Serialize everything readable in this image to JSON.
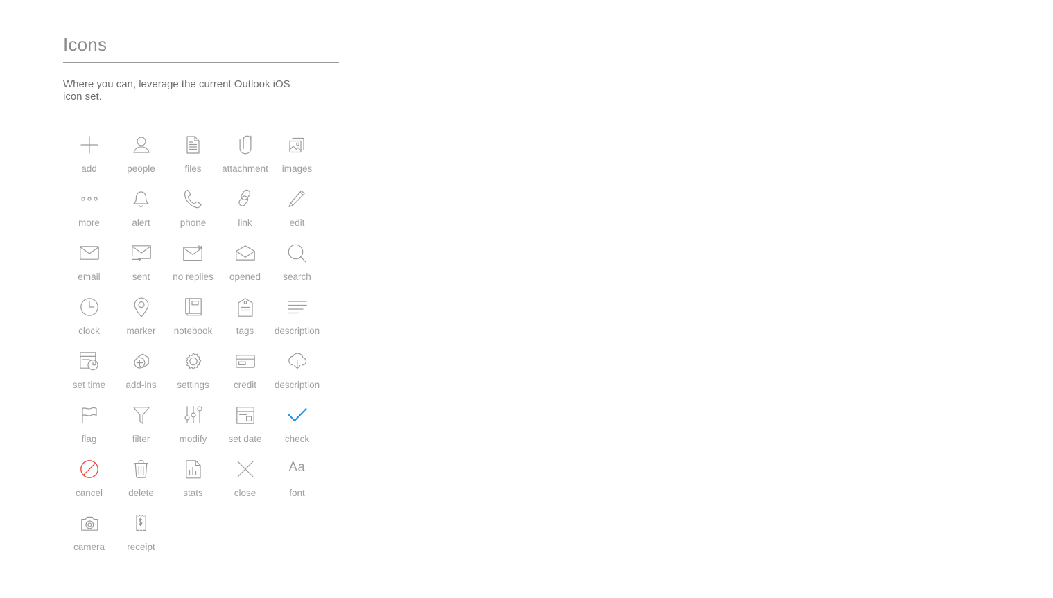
{
  "page": {
    "title": "Icons",
    "intro": "Where you can, leverage the current Outlook iOS icon set."
  },
  "colors": {
    "stroke": "#9b9b9b",
    "label": "#a0a0a0",
    "title": "#8c8c8c",
    "body_text": "#6d6d6d",
    "accent_blue": "#1f8fe0",
    "accent_red": "#e8453c",
    "background": "#ffffff"
  },
  "icons": [
    {
      "name": "add-icon",
      "label": "add"
    },
    {
      "name": "people-icon",
      "label": "people"
    },
    {
      "name": "files-icon",
      "label": "files"
    },
    {
      "name": "attachment-icon",
      "label": "attachment"
    },
    {
      "name": "images-icon",
      "label": "images"
    },
    {
      "name": "more-icon",
      "label": "more"
    },
    {
      "name": "alert-icon",
      "label": "alert"
    },
    {
      "name": "phone-icon",
      "label": "phone"
    },
    {
      "name": "link-icon",
      "label": "link"
    },
    {
      "name": "edit-icon",
      "label": "edit"
    },
    {
      "name": "email-icon",
      "label": "email"
    },
    {
      "name": "sent-icon",
      "label": "sent"
    },
    {
      "name": "no-replies-icon",
      "label": "no replies"
    },
    {
      "name": "opened-icon",
      "label": "opened"
    },
    {
      "name": "search-icon",
      "label": "search"
    },
    {
      "name": "clock-icon",
      "label": "clock"
    },
    {
      "name": "marker-icon",
      "label": "marker"
    },
    {
      "name": "notebook-icon",
      "label": "notebook"
    },
    {
      "name": "tags-icon",
      "label": "tags"
    },
    {
      "name": "description-icon",
      "label": "description"
    },
    {
      "name": "set-time-icon",
      "label": "set time"
    },
    {
      "name": "add-ins-icon",
      "label": "add-ins"
    },
    {
      "name": "settings-icon",
      "label": "settings"
    },
    {
      "name": "credit-icon",
      "label": "credit"
    },
    {
      "name": "cloud-download-icon",
      "label": "description"
    },
    {
      "name": "flag-icon",
      "label": "flag"
    },
    {
      "name": "filter-icon",
      "label": "filter"
    },
    {
      "name": "modify-icon",
      "label": "modify"
    },
    {
      "name": "set-date-icon",
      "label": "set date"
    },
    {
      "name": "check-icon",
      "label": "check",
      "accent": "blue"
    },
    {
      "name": "cancel-icon",
      "label": "cancel",
      "accent": "red"
    },
    {
      "name": "delete-icon",
      "label": "delete"
    },
    {
      "name": "stats-icon",
      "label": "stats"
    },
    {
      "name": "close-icon",
      "label": "close"
    },
    {
      "name": "font-icon",
      "label": "font",
      "glyph": "Aa"
    },
    {
      "name": "camera-icon",
      "label": "camera"
    },
    {
      "name": "receipt-icon",
      "label": "receipt"
    }
  ]
}
